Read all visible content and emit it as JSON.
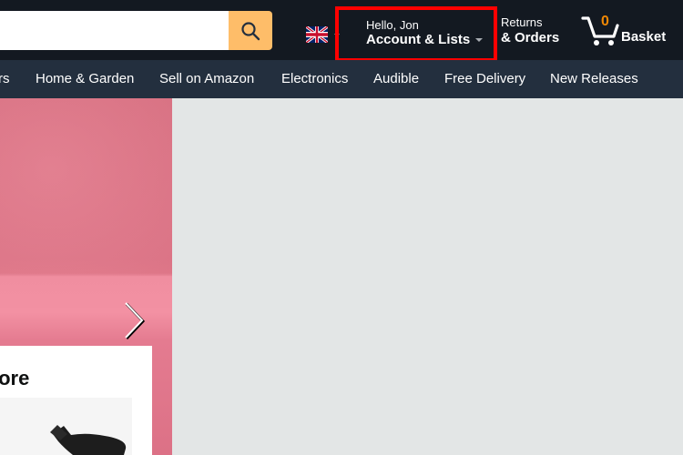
{
  "header": {
    "search": {
      "value": "",
      "placeholder": ""
    },
    "search_button_icon": "search-icon",
    "language_flag_icon": "uk-flag-icon",
    "account": {
      "greeting": "Hello, Jon",
      "label": "Account & Lists"
    },
    "returns": {
      "line1": "Returns",
      "line2": "& Orders"
    },
    "basket": {
      "count": "0",
      "label": "Basket"
    },
    "highlight_color": "#ff0000",
    "accent_color": "#febd69"
  },
  "nav": {
    "items": [
      {
        "label": "rs"
      },
      {
        "label": "Home & Garden"
      },
      {
        "label": "Sell on Amazon"
      },
      {
        "label": "Electronics"
      },
      {
        "label": "Audible"
      },
      {
        "label": "Free Delivery"
      },
      {
        "label": "New Releases"
      }
    ]
  },
  "hero": {
    "next_icon": "chevron-right-icon"
  },
  "card": {
    "title": "lore"
  }
}
